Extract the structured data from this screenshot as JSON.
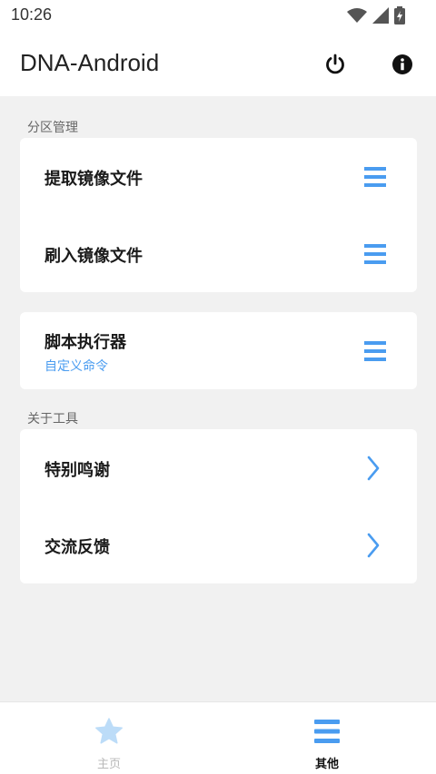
{
  "status_bar": {
    "time": "10:26"
  },
  "app_bar": {
    "title": "DNA-Android",
    "power_icon": "power-icon",
    "info_icon": "info-icon"
  },
  "sections": [
    {
      "label": "分区管理"
    },
    {
      "label": "关于工具"
    }
  ],
  "partition_card": {
    "items": [
      {
        "label": "提取镜像文件",
        "icon": "menu-icon"
      },
      {
        "label": "刷入镜像文件",
        "icon": "menu-icon"
      }
    ]
  },
  "script_card": {
    "title": "脚本执行器",
    "subtitle": "自定义命令",
    "icon": "menu-icon"
  },
  "about_card": {
    "items": [
      {
        "label": "特别鸣谢",
        "icon": "chevron-right-icon"
      },
      {
        "label": "交流反馈",
        "icon": "chevron-right-icon"
      }
    ]
  },
  "bottom_nav": {
    "items": [
      {
        "label": "主页",
        "icon": "star-icon",
        "active": false
      },
      {
        "label": "其他",
        "icon": "menu-icon",
        "active": true
      }
    ]
  },
  "colors": {
    "accent": "#4a9cf0",
    "nav_inactive": "#bcdcf8",
    "background": "#f1f1f1"
  }
}
